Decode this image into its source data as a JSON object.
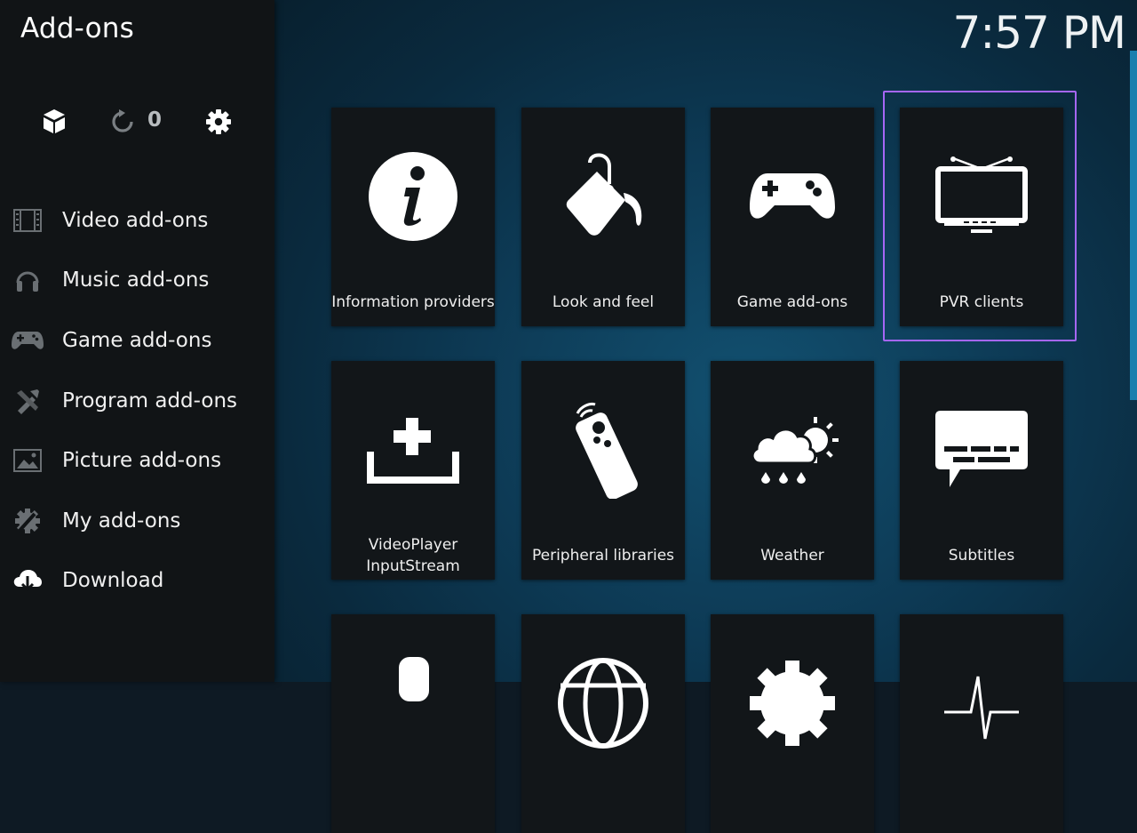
{
  "header": {
    "title": "Add-ons",
    "clock": "7:57 PM"
  },
  "toolbar": {
    "counter": "0",
    "icons": [
      "addon-box-icon",
      "update-refresh-icon",
      "settings-gear-icon"
    ]
  },
  "sidebar": {
    "items": [
      {
        "label": "Video add-ons",
        "icon": "film-icon"
      },
      {
        "label": "Music add-ons",
        "icon": "headphones-icon"
      },
      {
        "label": "Game add-ons",
        "icon": "gamepad-icon"
      },
      {
        "label": "Program add-ons",
        "icon": "tools-icon"
      },
      {
        "label": "Picture add-ons",
        "icon": "picture-icon"
      },
      {
        "label": "My add-ons",
        "icon": "wrench-gear-icon"
      },
      {
        "label": "Download",
        "icon": "cloud-download-icon"
      }
    ]
  },
  "grid": {
    "tiles": [
      {
        "label": "Information providers",
        "icon": "info-icon"
      },
      {
        "label": "Look and feel",
        "icon": "paint-bucket-icon"
      },
      {
        "label": "Game add-ons",
        "icon": "gamepad-icon"
      },
      {
        "label": "PVR clients",
        "icon": "tv-icon",
        "focused": true
      },
      {
        "label": "VideoPlayer InputStream",
        "icon": "inputstream-icon"
      },
      {
        "label": "Peripheral libraries",
        "icon": "remote-control-icon"
      },
      {
        "label": "Weather",
        "icon": "weather-icon"
      },
      {
        "label": "Subtitles",
        "icon": "subtitles-icon"
      },
      {
        "label": "",
        "icon": "microphone-icon"
      },
      {
        "label": "",
        "icon": "globe-icon"
      },
      {
        "label": "",
        "icon": "gear-icon"
      },
      {
        "label": "",
        "icon": "waveform-icon"
      }
    ]
  },
  "colors": {
    "focus": "#a566f5",
    "scrollbar": "#1a7fae"
  }
}
